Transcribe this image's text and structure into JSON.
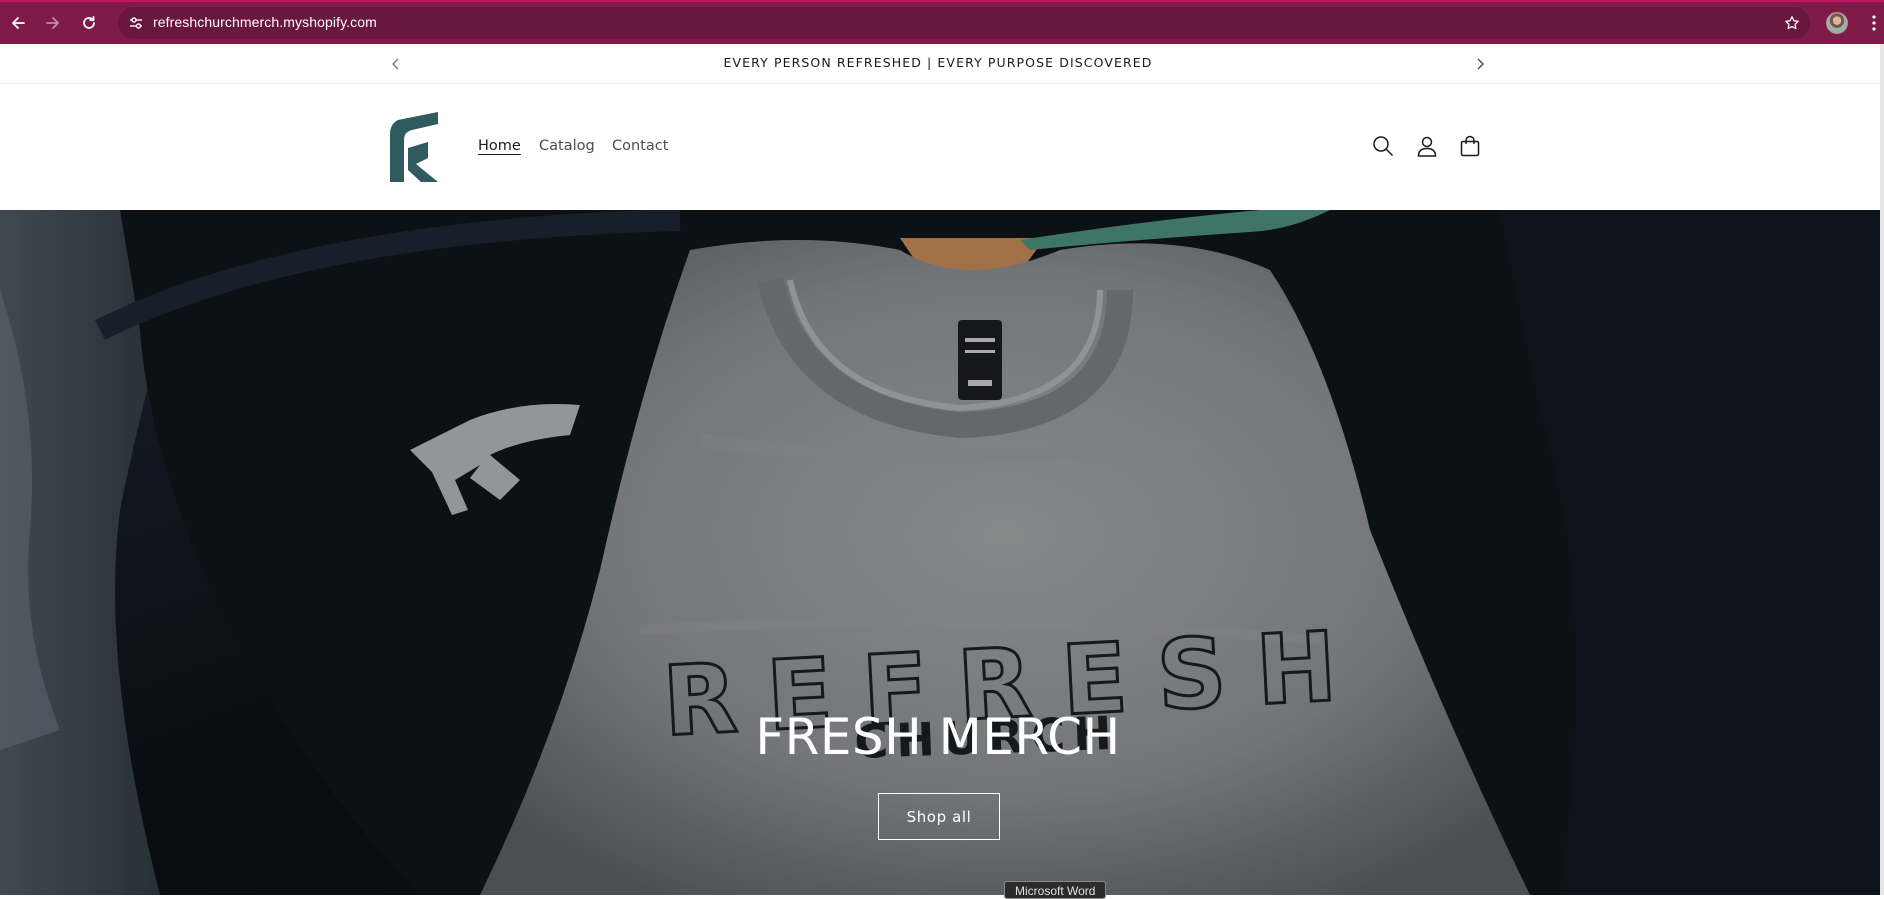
{
  "browser": {
    "url": "refreshchurchmerch.myshopify.com",
    "icons": [
      "back-arrow-icon",
      "forward-arrow-icon",
      "reload-icon",
      "site-settings-icon",
      "bookmark-star-icon",
      "profile-avatar",
      "more-menu-icon"
    ],
    "theme_color": "#7e1b49"
  },
  "announcement": {
    "text": "EVERY PERSON REFRESHED | EVERY PURPOSE DISCOVERED"
  },
  "header": {
    "nav": [
      {
        "label": "Home",
        "active": true
      },
      {
        "label": "Catalog",
        "active": false
      },
      {
        "label": "Contact",
        "active": false
      }
    ],
    "icons": [
      "search-icon",
      "account-icon",
      "cart-icon"
    ],
    "logo_color": "#2f5b5e"
  },
  "hero": {
    "heading": "FRESH MERCH",
    "button_label": "Shop all",
    "image_text": {
      "shirt_print": "REFRESH",
      "shirt_print_sub": "CHURCH"
    }
  },
  "tooltip": {
    "text": "Microsoft Word"
  }
}
